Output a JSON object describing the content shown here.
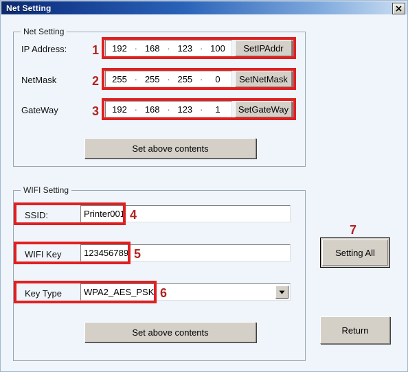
{
  "window": {
    "title": "Net Setting",
    "close_icon": "close-icon",
    "close_glyph": "×"
  },
  "net_group": {
    "title": "Net Setting",
    "rows": [
      {
        "label": "IP Address:",
        "octets": [
          "192",
          "168",
          "123",
          "100"
        ],
        "button": "SetIPAddr",
        "marker": "1"
      },
      {
        "label": "NetMask",
        "octets": [
          "255",
          "255",
          "255",
          "0"
        ],
        "button": "SetNetMask",
        "marker": "2"
      },
      {
        "label": "GateWay",
        "octets": [
          "192",
          "168",
          "123",
          "1"
        ],
        "button": "SetGateWay",
        "marker": "3"
      }
    ],
    "separator": ".",
    "set_button": "Set above contents"
  },
  "wifi_group": {
    "title": "WIFI Setting",
    "ssid": {
      "label": "SSID:",
      "value": "Printer001",
      "placeholder": "",
      "marker": "4"
    },
    "wifi_key": {
      "label": "WIFI Key",
      "value": "123456789",
      "placeholder": "",
      "marker": "5"
    },
    "key_type": {
      "label": "Key Type",
      "value": "WPA2_AES_PSK",
      "marker": "6",
      "arrow_icon": "chevron-down-icon"
    },
    "set_button": "Set above contents"
  },
  "side_panel": {
    "setting_all_button": "Setting All",
    "setting_all_marker": "7",
    "return_button": "Return"
  },
  "colors": {
    "annotation_red": "#e02020",
    "marker_red": "#b22222",
    "window_background": "#eff5fb",
    "button_face": "#d4d0c8",
    "titlebar_start": "#0b2a6b",
    "titlebar_end": "#cddff2"
  }
}
